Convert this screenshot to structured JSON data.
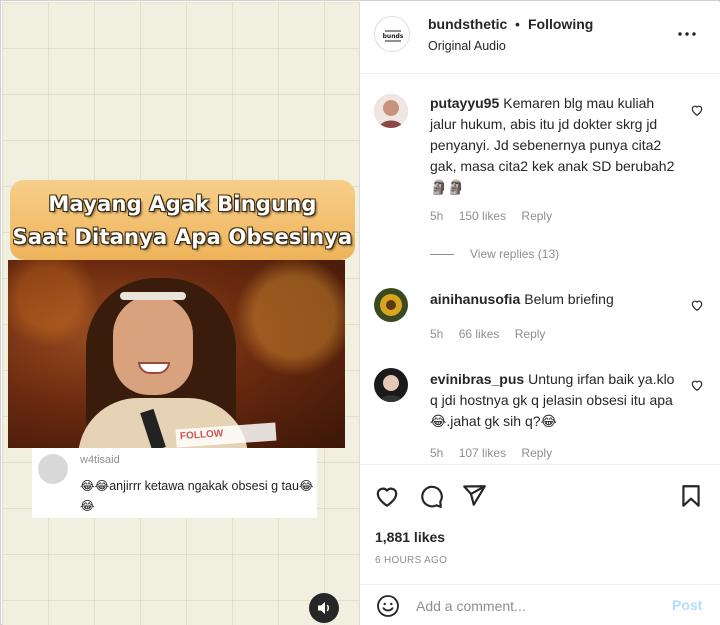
{
  "media": {
    "caption_line1": "Mayang Agak Bingung",
    "caption_line2": "Saat Ditanya Apa Obsesinya",
    "follow_overlay": "FOLLOW",
    "tiktok_comment": {
      "user": "w4tisaid",
      "text": "😂😂anjirrr ketawa ngakak obsesi g tau😂😂"
    },
    "mute_icon": "speaker-icon"
  },
  "header": {
    "username": "bundsthetic",
    "separator": "•",
    "following_label": "Following",
    "audio": "Original Audio",
    "more_icon": "more-horizontal-icon"
  },
  "comments": [
    {
      "user": "putayyu95",
      "text": "Kemaren blg mau kuliah jalur hukum, abis itu jd dokter skrg jd penyanyi. Jd sebenernya punya cita2 gak, masa cita2 kek anak SD berubah2 🗿🗿",
      "time": "5h",
      "likes": "150 likes",
      "reply": "Reply",
      "view_replies": "View replies (13)"
    },
    {
      "user": "ainihanusofia",
      "text": "Belum briefing",
      "time": "5h",
      "likes": "66 likes",
      "reply": "Reply"
    },
    {
      "user": "evinibras_pus",
      "text": "Untung irfan baik ya.klo q jdi hostnya gk q jelasin obsesi itu apa 😂.jahat gk sih q?😂",
      "time": "5h",
      "likes": "107 likes",
      "reply": "Reply"
    }
  ],
  "actions": {
    "like_icon": "heart-icon",
    "comment_icon": "comment-icon",
    "share_icon": "send-icon",
    "save_icon": "bookmark-icon",
    "likes_count": "1,881 likes",
    "timestamp": "6 HOURS AGO"
  },
  "add_comment": {
    "placeholder": "Add a comment...",
    "post_label": "Post",
    "emoji_icon": "smiley-icon"
  },
  "colors": {
    "link_blue_disabled": "#b3dbff",
    "muted_gray": "#8e8e8e",
    "text": "#262626"
  }
}
